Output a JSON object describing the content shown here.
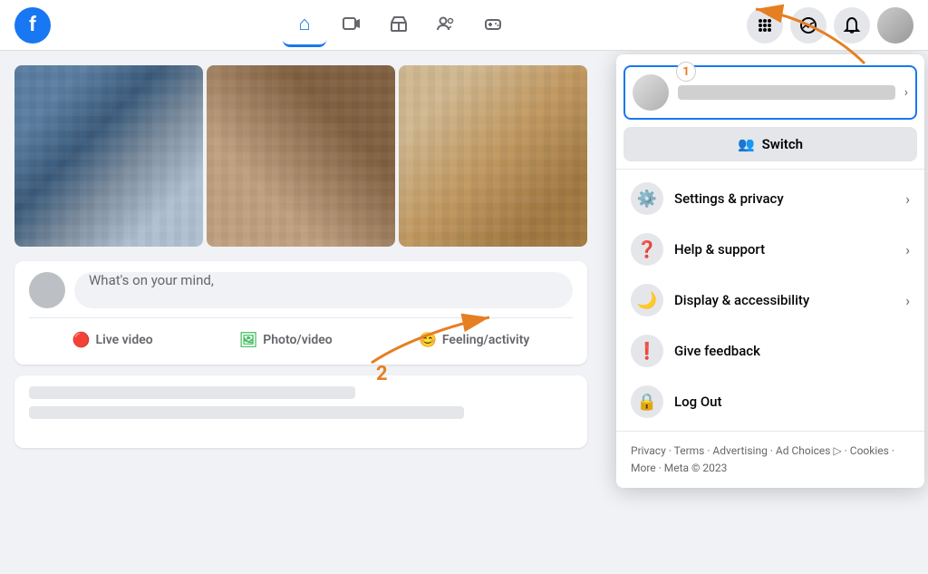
{
  "nav": {
    "logo": "f",
    "icons": [
      {
        "name": "home",
        "symbol": "⌂",
        "active": true
      },
      {
        "name": "video",
        "symbol": "▶",
        "active": false
      },
      {
        "name": "store",
        "symbol": "⊞",
        "active": false
      },
      {
        "name": "people",
        "symbol": "👤",
        "active": false
      },
      {
        "name": "gaming",
        "symbol": "🎮",
        "active": false
      }
    ],
    "right_icons": [
      {
        "name": "grid",
        "symbol": "⋮⋮⋮"
      },
      {
        "name": "messenger",
        "symbol": "💬"
      },
      {
        "name": "bell",
        "symbol": "🔔"
      }
    ]
  },
  "feed": {
    "post_placeholder": "What's on your mind,",
    "actions": [
      {
        "id": "live",
        "label": "Live video",
        "icon": "🔴"
      },
      {
        "id": "photo",
        "label": "Photo/video",
        "icon": "🖼"
      },
      {
        "id": "feeling",
        "label": "Feeling/activity",
        "icon": "😊"
      }
    ]
  },
  "dropdown": {
    "profile_number": "1",
    "switch_icon": "👥",
    "switch_label": "Switch",
    "items": [
      {
        "id": "settings",
        "icon": "⚙",
        "label": "Settings & privacy",
        "has_chevron": true
      },
      {
        "id": "help",
        "icon": "❓",
        "label": "Help & support",
        "has_chevron": true
      },
      {
        "id": "display",
        "icon": "🌙",
        "label": "Display & accessibility",
        "has_chevron": true
      },
      {
        "id": "feedback",
        "icon": "❗",
        "label": "Give feedback",
        "has_chevron": false
      },
      {
        "id": "logout",
        "icon": "🔒",
        "label": "Log Out",
        "has_chevron": false
      }
    ],
    "footer": "Privacy · Terms · Advertising · Ad Choices ▷ · Cookies · More · Meta © 2023"
  },
  "arrows": {
    "label1": "1",
    "label2": "2"
  }
}
